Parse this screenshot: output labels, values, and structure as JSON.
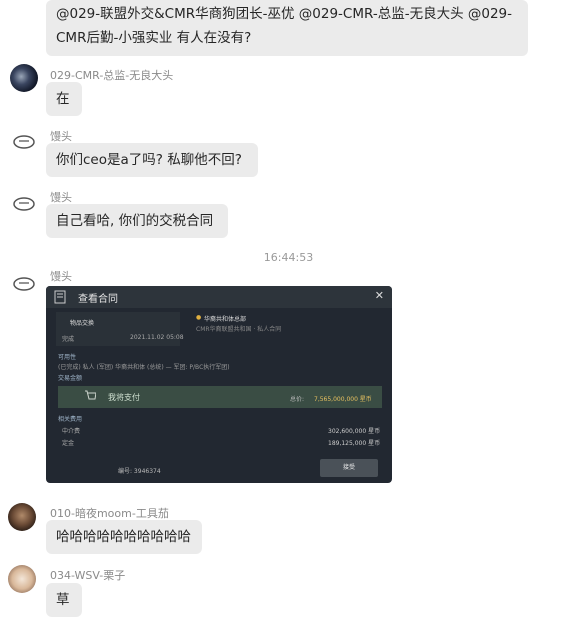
{
  "messages": [
    {
      "text_line1": "@029-联盟外交&CMR华商狗团长-巫优 @029-CMR-总监-无良大头 @029-",
      "text_line2": "CMR后勤-小强实业 有人在没有?"
    },
    {
      "sender": "029-CMR-总监-无良大头",
      "text": "在"
    },
    {
      "sender": "馒头",
      "text": "你们ceo是a了吗? 私聊他不回?"
    },
    {
      "sender": "馒头",
      "text": "自己看哈, 你们的交税合同"
    },
    {
      "sender": "馒头"
    },
    {
      "sender": "010-暗夜moom-工具茄",
      "text": "哈哈哈哈哈哈哈哈哈哈"
    },
    {
      "sender": "034-WSV-栗子",
      "text": "草"
    }
  ],
  "timestamp": "16:44:53",
  "game": {
    "title": "查看合同",
    "close": "✕",
    "item_exchange": "物品交换",
    "status": "完成",
    "date": "2021.11.02 05:08",
    "location": "华裔共和体总部",
    "location_sub": "CMR华裔联盟共和国 · 私人合同",
    "availability_label": "可用性",
    "availability_value": "(已完成)  私人 (军团) 华裔共和体 (总统) — 军团: P/BC执行军团)",
    "trade_label": "交易金额",
    "pay_label": "我将支付",
    "total_label": "总价:",
    "total_value": "7,565,000,000 星币",
    "fee_label": "相关费用",
    "broker_label": "中介费",
    "broker_value": "302,600,000 星币",
    "tax_label": "定金",
    "tax_value": "189,125,000 星币",
    "id_label": "编号: 3946374",
    "submit": "接受"
  }
}
